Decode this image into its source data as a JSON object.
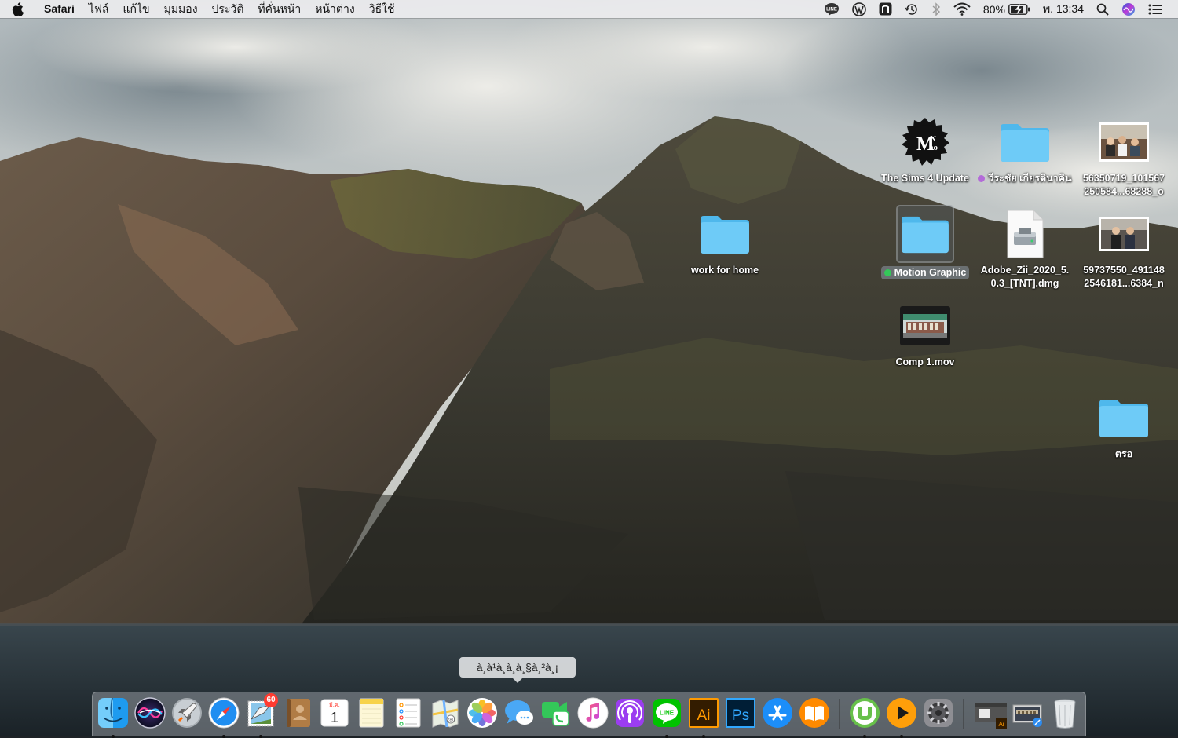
{
  "menubar": {
    "app_name": "Safari",
    "menus": [
      "ไฟล์",
      "แก้ไข",
      "มุมมอง",
      "ประวัติ",
      "ที่คั่นหน้า",
      "หน้าต่าง",
      "วิธีใช้"
    ],
    "status": {
      "line_icon_text": "LINE",
      "battery_percent": "80%",
      "clock": "พ. 13:34"
    }
  },
  "desktop": {
    "icons": [
      {
        "label": "The Sims 4 Update",
        "kind": "mao-logo-icon",
        "logo_text": "M N ao"
      },
      {
        "label": "วีระชัย เกียรตินาคิน",
        "kind": "folder-icon",
        "tag_color": "#b36bd8"
      },
      {
        "label": "56350719_101567",
        "label2": "250584...68288_o",
        "kind": "photo-thumbnail-icon"
      },
      {
        "label": "work for home",
        "kind": "folder-icon"
      },
      {
        "label": "Motion Graphic",
        "kind": "folder-icon",
        "tag_color": "#34c759",
        "selected": true
      },
      {
        "label": "Adobe_Zii_2020_5.",
        "label2": "0.3_[TNT].dmg",
        "kind": "disk-image-icon"
      },
      {
        "label": "59737550_491148",
        "label2": "2546181...6384_n",
        "kind": "photo-thumbnail-icon"
      },
      {
        "label": "Comp 1.mov",
        "kind": "video-thumbnail-icon"
      },
      {
        "label": "ตรอ",
        "kind": "folder-icon"
      }
    ]
  },
  "tooltip": {
    "text": "à¸à¹à¸à¸à¸§à¸²à¸¡"
  },
  "dock": {
    "items": [
      {
        "name": "finder",
        "running": true
      },
      {
        "name": "siri",
        "running": false
      },
      {
        "name": "launchpad",
        "running": false
      },
      {
        "name": "safari",
        "running": true
      },
      {
        "name": "mail",
        "running": true,
        "badge": "60"
      },
      {
        "name": "contacts",
        "running": false
      },
      {
        "name": "calendar",
        "running": false,
        "month": "มี.ค.",
        "day": "1"
      },
      {
        "name": "notes",
        "running": false
      },
      {
        "name": "reminders",
        "running": false
      },
      {
        "name": "maps",
        "running": false
      },
      {
        "name": "photos",
        "running": false
      },
      {
        "name": "messages",
        "running": false
      },
      {
        "name": "facetime",
        "running": false
      },
      {
        "name": "itunes",
        "running": false
      },
      {
        "name": "podcasts",
        "running": false
      },
      {
        "name": "line",
        "running": true,
        "text": "LINE"
      },
      {
        "name": "illustrator",
        "running": true,
        "text": "Ai"
      },
      {
        "name": "photoshop",
        "running": false,
        "text": "Ps"
      },
      {
        "name": "app-store",
        "running": false
      },
      {
        "name": "books",
        "running": false
      },
      {
        "name": "utorrent",
        "running": true
      },
      {
        "name": "infuse-player",
        "running": true
      },
      {
        "name": "system-preferences",
        "running": false
      },
      {
        "name": "minimized-illustrator-window",
        "running": false,
        "text": "Ai"
      },
      {
        "name": "downloads-stack",
        "running": false
      },
      {
        "name": "trash",
        "running": false
      }
    ]
  },
  "colors": {
    "folder": "#5fc6f5",
    "menubar_bg": "#ececee",
    "line_green": "#00c300",
    "ai_orange": "#ff9a00",
    "ps_blue": "#31a8ff"
  }
}
